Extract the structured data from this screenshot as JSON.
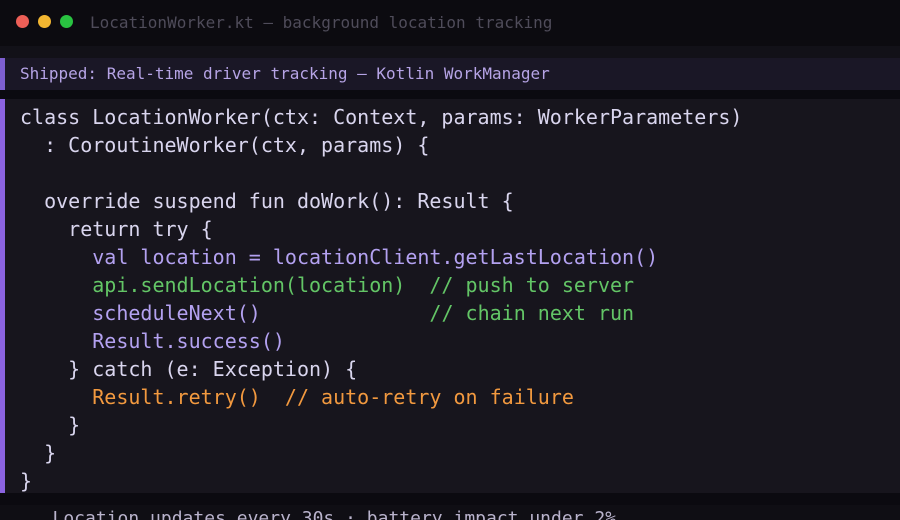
{
  "window": {
    "title": "LocationWorker.kt — background location tracking",
    "controls": [
      "close",
      "minimize",
      "maximize"
    ]
  },
  "banner": {
    "text": "Shipped: Real-time driver tracking — Kotlin WorkManager"
  },
  "code": {
    "language": "kotlin",
    "lines": [
      {
        "text": "class LocationWorker(ctx: Context, params: WorkerParameters)"
      },
      {
        "text": "  : CoroutineWorker(ctx, params) {"
      },
      {
        "text": ""
      },
      {
        "text": "  override suspend fun doWork(): Result {"
      },
      {
        "text": "    return try {"
      },
      {
        "code": "      val location = locationClient.getLastLocation()"
      },
      {
        "code": "      api.sendLocation(location)",
        "comment": "  // push to server"
      },
      {
        "code": "      scheduleNext()",
        "comment": "              // chain next run"
      },
      {
        "code": "      Result.success()"
      },
      {
        "text": "    } catch (e: Exception) {"
      },
      {
        "code": "      Result.retry()",
        "comment": "  // auto-retry on failure"
      },
      {
        "text": "    }"
      },
      {
        "text": "  }"
      },
      {
        "text": "}"
      }
    ]
  },
  "colors": {
    "accent": "#8b63e0",
    "comment": "#63c566",
    "retry": "#f2993f",
    "call": "#b3a1f0"
  },
  "footer": {
    "text": "   Location updates every 30s · battery impact under 2%"
  }
}
